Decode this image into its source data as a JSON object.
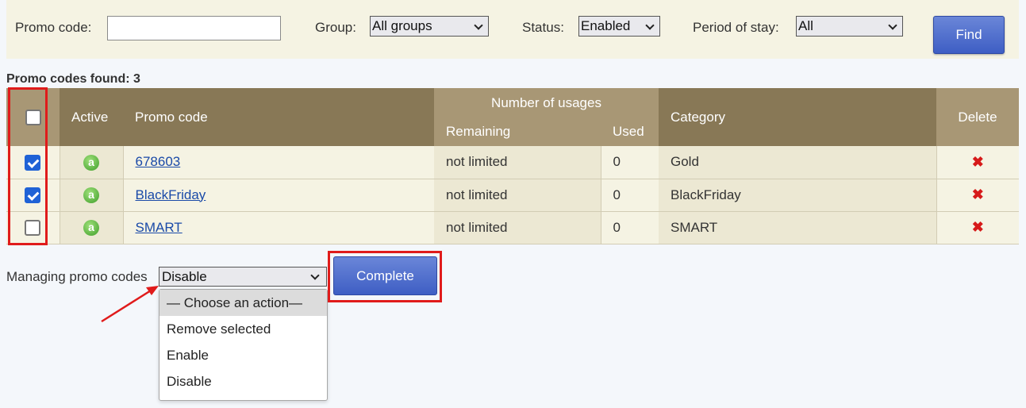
{
  "filters": {
    "promo_code_label": "Promo code:",
    "promo_code_value": "",
    "group_label": "Group:",
    "group_value": "All groups",
    "status_label": "Status:",
    "status_value": "Enabled",
    "period_label": "Period of stay:",
    "period_value": "All",
    "find_label": "Find"
  },
  "found_text": "Promo codes found: 3",
  "table": {
    "headers": {
      "active": "Active",
      "promo_code": "Promo code",
      "number_of_usages": "Number of usages",
      "remaining": "Remaining",
      "used": "Used",
      "category": "Category",
      "delete": "Delete"
    },
    "select_all_checked": false,
    "rows": [
      {
        "checked": true,
        "active_icon": "a",
        "code": "678603",
        "remaining": "not limited",
        "used": "0",
        "category": "Gold",
        "delete_icon": "✖"
      },
      {
        "checked": true,
        "active_icon": "a",
        "code": "BlackFriday",
        "remaining": "not limited",
        "used": "0",
        "category": "BlackFriday",
        "delete_icon": "✖"
      },
      {
        "checked": false,
        "active_icon": "a",
        "code": "SMART",
        "remaining": "not limited",
        "used": "0",
        "category": "SMART",
        "delete_icon": "✖"
      }
    ]
  },
  "manage": {
    "label": "Managing promo codes",
    "selected": "Disable",
    "options": [
      "— Choose an action—",
      "Remove selected",
      "Enable",
      "Disable"
    ],
    "complete_label": "Complete"
  },
  "colors": {
    "header_dark": "#887856",
    "header_light": "#a89775",
    "row_dark": "#ece8d3",
    "row_light": "#f5f3e3",
    "button_blue": "#4a66cc",
    "highlight_red": "#e01b1b"
  }
}
